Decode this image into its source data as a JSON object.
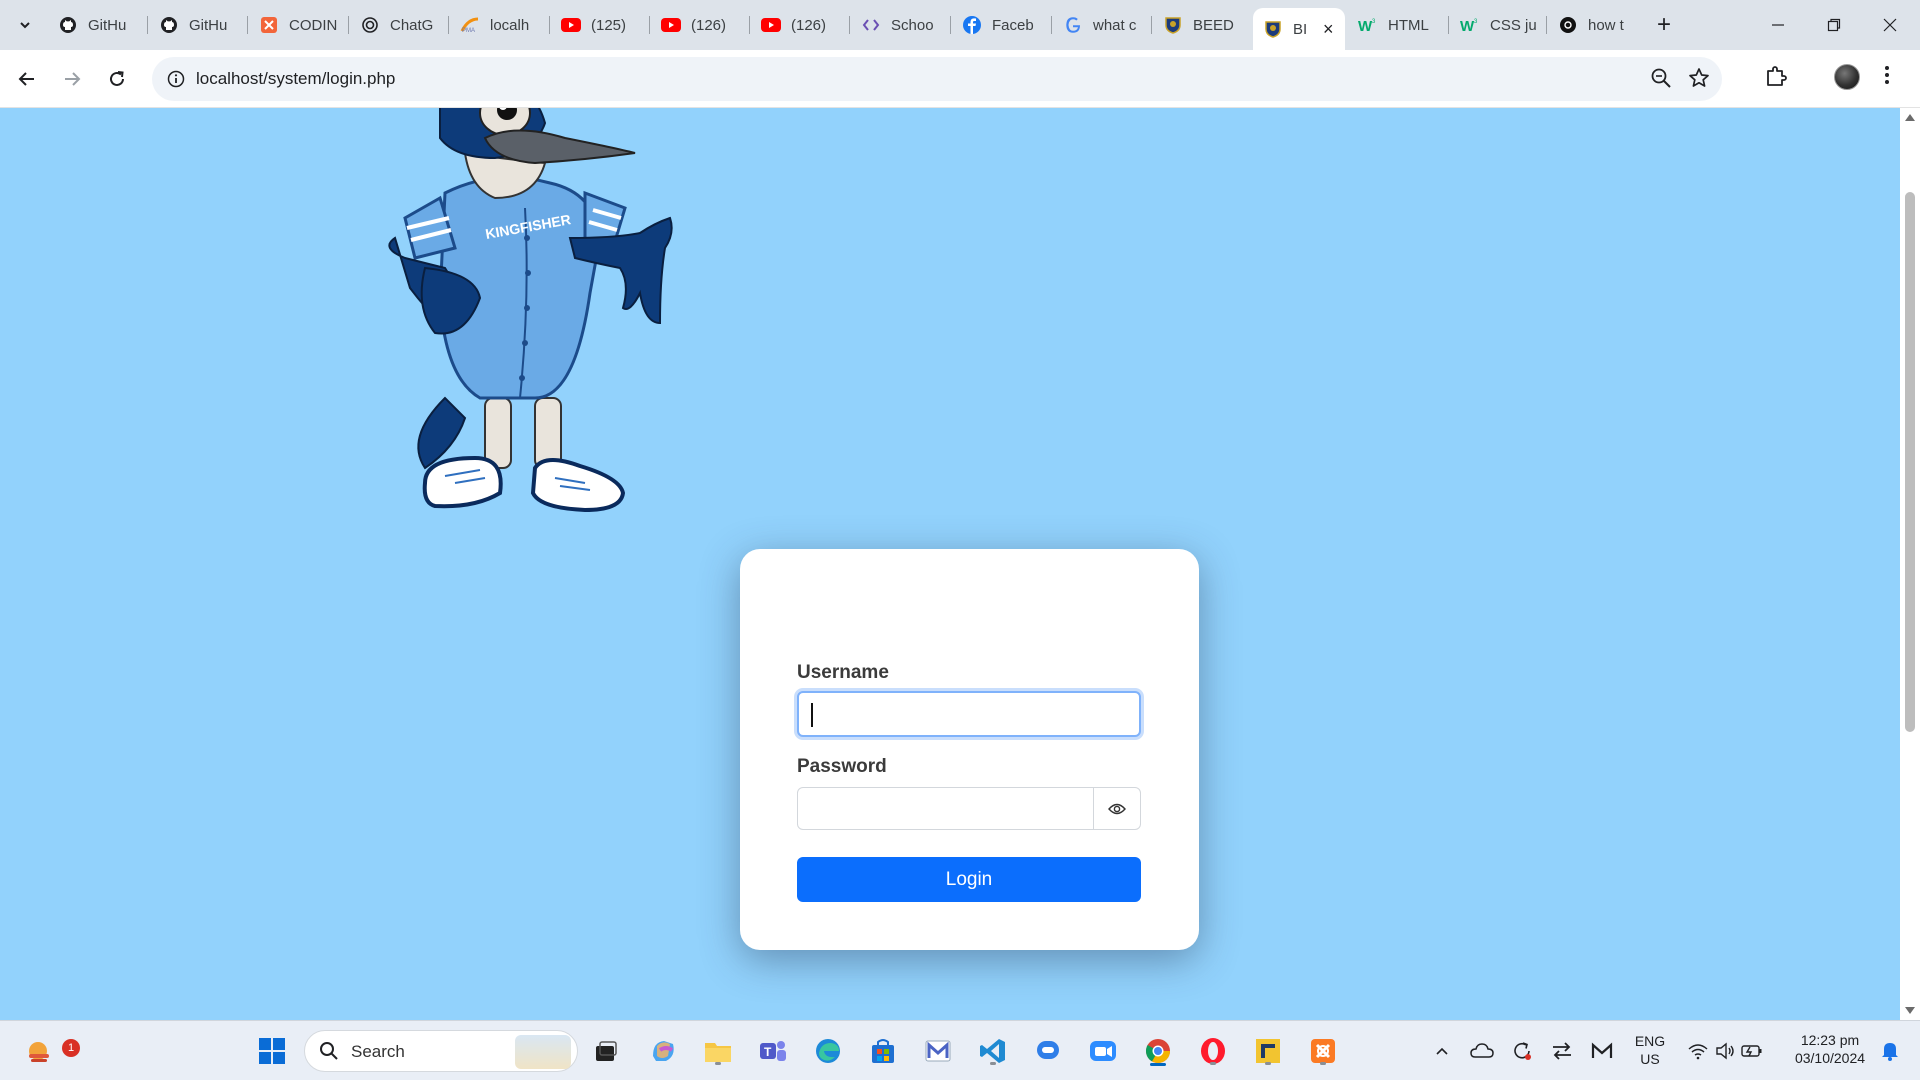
{
  "browser": {
    "tabs": [
      {
        "title": "GitHu",
        "icon": "github-icon"
      },
      {
        "title": "GitHu",
        "icon": "github-icon"
      },
      {
        "title": "CODIN",
        "icon": "codingal-icon"
      },
      {
        "title": "ChatG",
        "icon": "chatgpt-icon"
      },
      {
        "title": "localh",
        "icon": "phpmyadmin-icon"
      },
      {
        "title": "(125)",
        "icon": "youtube-icon"
      },
      {
        "title": "(126)",
        "icon": "youtube-icon"
      },
      {
        "title": "(126)",
        "icon": "youtube-icon"
      },
      {
        "title": "Schoo",
        "icon": "code-icon"
      },
      {
        "title": "Faceb",
        "icon": "facebook-icon"
      },
      {
        "title": "what c",
        "icon": "google-icon"
      },
      {
        "title": "BEED",
        "icon": "school-crest-icon"
      },
      {
        "title": "BI",
        "icon": "school-crest-icon",
        "active": true
      },
      {
        "title": "HTML",
        "icon": "w3schools-icon"
      },
      {
        "title": "CSS ju",
        "icon": "w3schools-icon"
      },
      {
        "title": "how t",
        "icon": "openai-icon"
      }
    ],
    "url": "localhost/system/login.php"
  },
  "login": {
    "username_label": "Username",
    "username_value": "",
    "password_label": "Password",
    "password_value": "",
    "login_button": "Login"
  },
  "mascot": {
    "jersey_text": "KINGFISHER"
  },
  "taskbar": {
    "search_label": "Search",
    "weather_badge": "1",
    "lang_line1": "ENG",
    "lang_line2": "US",
    "time": "12:23 pm",
    "date": "03/10/2024"
  },
  "colors": {
    "page_background": "#92d2fc",
    "login_button": "#0b6efd",
    "card": "#ffffff"
  }
}
